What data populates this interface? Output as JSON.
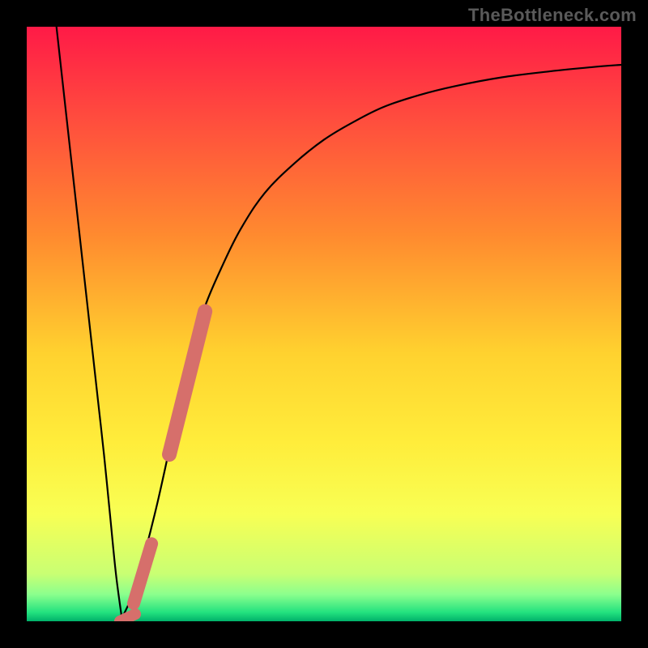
{
  "watermark": "TheBottleneck.com",
  "chart_data": {
    "type": "line",
    "title": "",
    "xlabel": "",
    "ylabel": "",
    "xlim": [
      0,
      100
    ],
    "ylim": [
      0,
      100
    ],
    "description": "Bottleneck curve over a red→yellow→green vertical gradient background. Left branch drops steeply from top-left to a minimum near x≈15; right branch rises from the minimum and asymptotes toward the top-right.",
    "gradient_stops": [
      {
        "offset": 0.0,
        "color": "#ff1a47"
      },
      {
        "offset": 0.15,
        "color": "#ff4b3e"
      },
      {
        "offset": 0.35,
        "color": "#ff8a2f"
      },
      {
        "offset": 0.55,
        "color": "#ffd22f"
      },
      {
        "offset": 0.7,
        "color": "#ffed3b"
      },
      {
        "offset": 0.82,
        "color": "#f8ff54"
      },
      {
        "offset": 0.92,
        "color": "#c9ff73"
      },
      {
        "offset": 0.955,
        "color": "#8bff8d"
      },
      {
        "offset": 0.985,
        "color": "#23e27f"
      },
      {
        "offset": 1.0,
        "color": "#00b16a"
      }
    ],
    "series": [
      {
        "name": "left-branch",
        "x": [
          5,
          6,
          7,
          8,
          9,
          10,
          11,
          12,
          13,
          14,
          15,
          16
        ],
        "y": [
          100,
          91,
          82,
          73,
          64,
          55,
          46,
          37,
          28,
          18,
          8,
          0.5
        ]
      },
      {
        "name": "right-branch",
        "x": [
          16,
          18,
          20,
          22,
          24,
          26,
          28,
          30,
          33,
          36,
          40,
          45,
          50,
          55,
          60,
          66,
          72,
          80,
          88,
          95,
          100
        ],
        "y": [
          0.5,
          5,
          12,
          20,
          29,
          38,
          46,
          53,
          60,
          66,
          72,
          77,
          81,
          84,
          86.5,
          88.5,
          90,
          91.5,
          92.5,
          93.2,
          93.6
        ]
      }
    ],
    "highlights": [
      {
        "name": "highlight-upper",
        "x0": 24.0,
        "y0": 28.0,
        "x1": 30.0,
        "y1": 52.0,
        "thickness_px": 18
      },
      {
        "name": "highlight-lower",
        "x0": 18.0,
        "y0": 3.0,
        "x1": 21.0,
        "y1": 13.0,
        "thickness_px": 16
      },
      {
        "name": "highlight-min",
        "x0": 15.6,
        "y0": 0.0,
        "x1": 18.2,
        "y1": 1.2,
        "thickness_px": 14
      }
    ]
  }
}
